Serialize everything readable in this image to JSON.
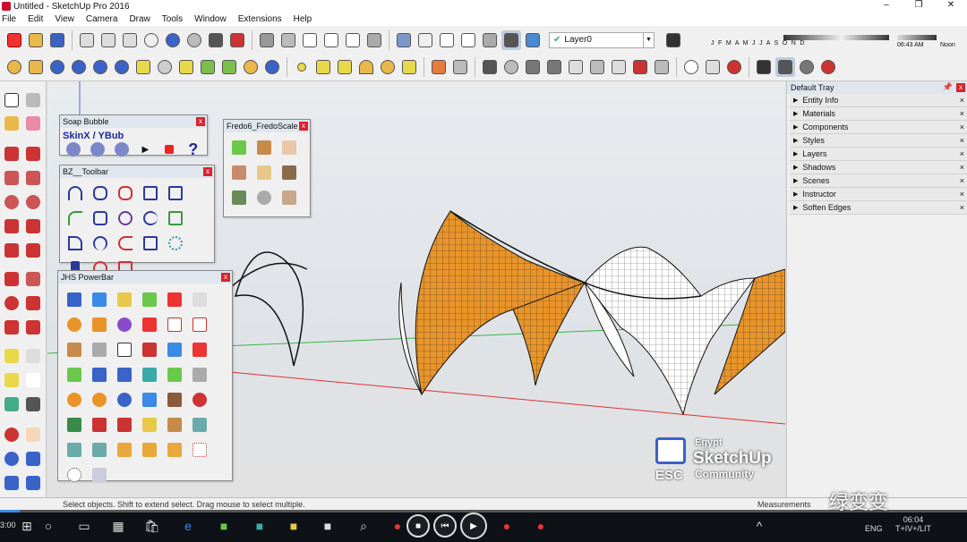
{
  "window": {
    "title": "Untitled - SketchUp Pro 2016",
    "controls": [
      "–",
      "❐",
      "✕"
    ]
  },
  "menu": [
    "File",
    "Edit",
    "View",
    "Camera",
    "Draw",
    "Tools",
    "Window",
    "Extensions",
    "Help"
  ],
  "toolbar": {
    "layer_value": "Layer0",
    "shadow_months": "J F M A M J J A S O N D",
    "shadow_time": "06:43 AM",
    "shadow_noon": "Noon"
  },
  "panels": {
    "soap_bubble": {
      "title": "Soap Bubble",
      "label": "SkinX / YBub"
    },
    "bz_toolbar": {
      "title": "BZ__Toolbar"
    },
    "jhs_powerbar": {
      "title": "JHS PowerBar"
    },
    "fredo_scale": {
      "title": "Fredo6_FredoScale"
    }
  },
  "tray": {
    "title": "Default Tray",
    "items": [
      "Entity Info",
      "Materials",
      "Components",
      "Styles",
      "Layers",
      "Shadows",
      "Scenes",
      "Instructor",
      "Soften Edges"
    ]
  },
  "status": {
    "text": "Select objects. Shift to extend select. Drag mouse to select multiple.",
    "measurements": "Measurements"
  },
  "taskbar": {
    "time_left": "3:00",
    "lang": "ENG",
    "clock": "06:04",
    "clock2": "T+IV+/LIT"
  },
  "watermark": {
    "brand_line1": "Egypt",
    "brand_line2": "SketchUp",
    "brand_line3": "Community",
    "brand_esc": "ESC",
    "wechat": "绿变变"
  },
  "colors": {
    "orange": "#e8942a",
    "accent_red": "#d9232e",
    "blue": "#3a63c8"
  }
}
